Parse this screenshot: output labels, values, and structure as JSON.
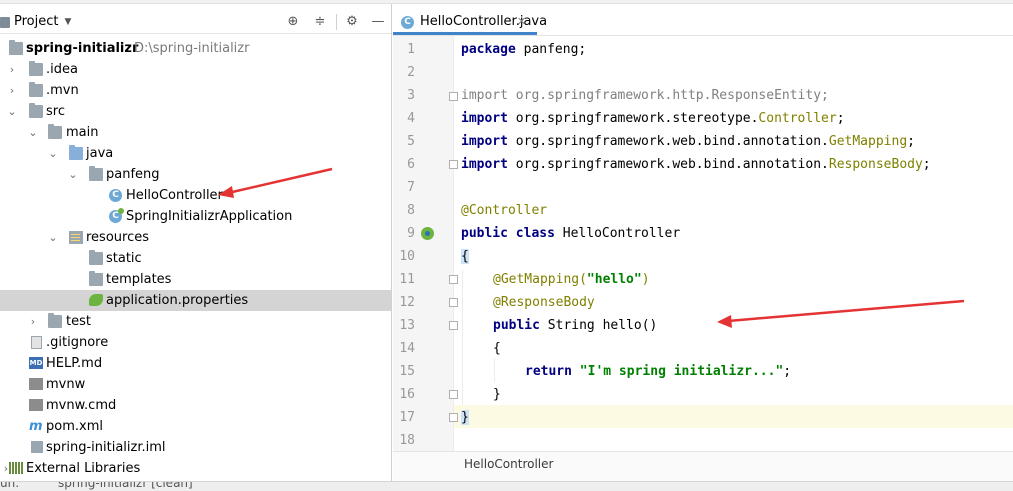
{
  "project_panel": {
    "title": "Project",
    "tree": [
      {
        "label": "spring-initializr",
        "path": "D:\\spring-initializr",
        "bold": true
      },
      {
        "label": ".idea"
      },
      {
        "label": ".mvn"
      },
      {
        "label": "src"
      },
      {
        "label": "main"
      },
      {
        "label": "java"
      },
      {
        "label": "panfeng"
      },
      {
        "label": "HelloController"
      },
      {
        "label": "SpringInitializrApplication"
      },
      {
        "label": "resources"
      },
      {
        "label": "static"
      },
      {
        "label": "templates"
      },
      {
        "label": "application.properties",
        "selected": true
      },
      {
        "label": "test"
      },
      {
        "label": ".gitignore"
      },
      {
        "label": "HELP.md"
      },
      {
        "label": "mvnw"
      },
      {
        "label": "mvnw.cmd"
      },
      {
        "label": "pom.xml"
      },
      {
        "label": "spring-initializr.iml"
      },
      {
        "label": "External Libraries"
      }
    ],
    "md_badge": "MD"
  },
  "editor": {
    "tab_label": "HelloController.java",
    "class_badge": "C",
    "line_numbers": [
      "1",
      "2",
      "3",
      "4",
      "5",
      "6",
      "7",
      "8",
      "9",
      "10",
      "11",
      "12",
      "13",
      "14",
      "15",
      "16",
      "17",
      "18"
    ],
    "code": {
      "l1_kw": "package",
      "l1_rest": " panfeng;",
      "l3_kw": "import",
      "l3_rest": " org.springframework.http.ResponseEntity;",
      "l4_kw": "import",
      "l4_pkg": " org.springframework.stereotype.",
      "l4_cls": "Controller",
      "l4_end": ";",
      "l5_kw": "import",
      "l5_pkg": " org.springframework.web.bind.annotation.",
      "l5_cls": "GetMapping",
      "l5_end": ";",
      "l6_kw": "import",
      "l6_pkg": " org.springframework.web.bind.annotation.",
      "l6_cls": "ResponseBody",
      "l6_end": ";",
      "l8": "@Controller",
      "l9_kw1": "public",
      "l9_kw2": "class",
      "l9_name": " HelloController",
      "l10": "{",
      "l11_ann": "@GetMapping(",
      "l11_str": "\"hello\"",
      "l11_end": ")",
      "l12": "@ResponseBody",
      "l13_kw": "public",
      "l13_rest": " String hello()",
      "l14": "{",
      "l15_kw": "return",
      "l15_str": "\"I'm spring initializr...\"",
      "l15_end": ";",
      "l16": "}",
      "l17": "}"
    },
    "breadcrumb": "HelloController"
  },
  "bottom_bar": {
    "left": "un:",
    "run_config": "spring-initializr [clean]"
  },
  "colors": {
    "keyword": "#000080",
    "annotation": "#808000",
    "string": "#008000",
    "selection": "#d4d4d4",
    "current_line": "#fcfae3",
    "arrow": "#e53333"
  }
}
